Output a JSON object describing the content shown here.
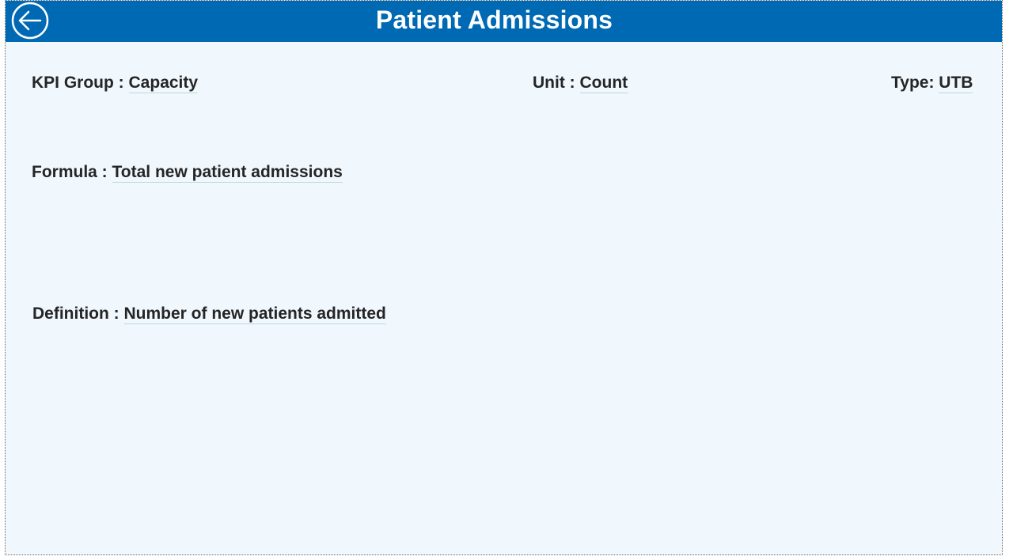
{
  "header": {
    "title": "Patient Admissions",
    "back_icon": "arrow-left-circle-icon",
    "background_color": "#0069b4"
  },
  "fields": {
    "kpi_group": {
      "label": "KPI Group :",
      "value": "Capacity"
    },
    "unit": {
      "label": "Unit :",
      "value": "Count"
    },
    "type": {
      "label": "Type:",
      "value": "UTB"
    },
    "formula": {
      "label": "Formula :",
      "value": "Total new patient admissions"
    },
    "definition": {
      "label": "Definition :",
      "value": "Number of new patients admitted"
    }
  },
  "colors": {
    "panel_background": "#f0f7fd",
    "text": "#252525",
    "title_text": "#ffffff"
  }
}
